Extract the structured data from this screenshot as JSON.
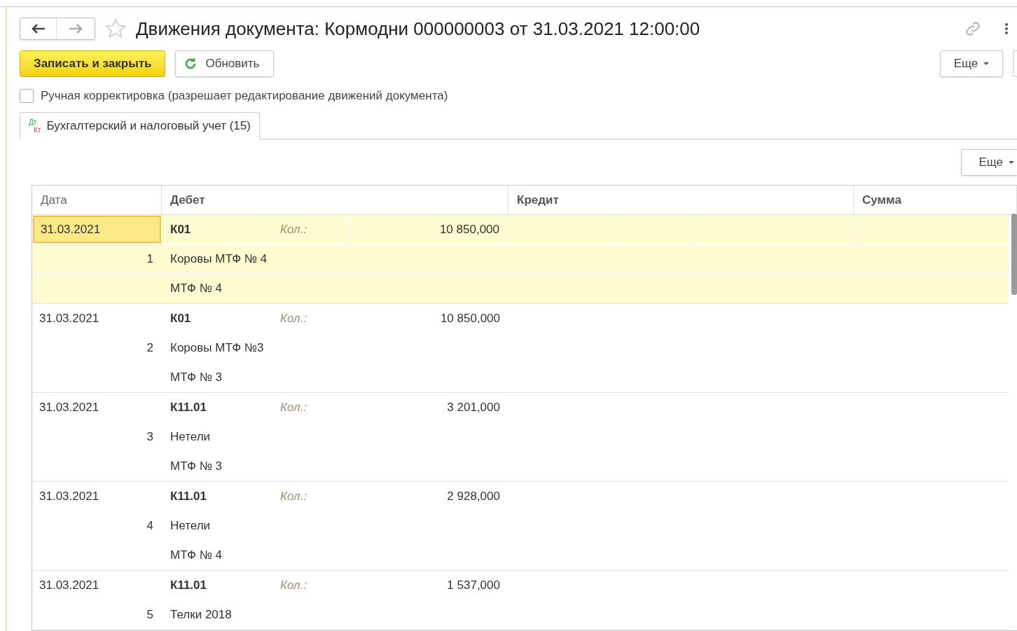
{
  "window": {
    "title": "Движения документа: Кормодни 000000003 от 31.03.2021 12:00:00"
  },
  "toolbar": {
    "save_close": "Записать и закрыть",
    "refresh": "Обновить",
    "more": "Еще"
  },
  "manual_edit": {
    "label": "Ручная корректировка (разрешает редактирование движений документа)",
    "checked": false
  },
  "tabs": [
    {
      "label": "Бухгалтерский и налоговый учет (15)",
      "icon_debit": "Дт",
      "icon_credit": "Кт",
      "selected": true
    }
  ],
  "table": {
    "more": "Еще",
    "columns": [
      "Дата",
      "Дебет",
      "Кредит",
      "Сумма"
    ],
    "rows": [
      {
        "date": "31.03.2021",
        "number": "1",
        "account": "К01",
        "qty_label": "Кол.:",
        "qty": "10 850,000",
        "subconto_1": "Коровы МТФ № 4",
        "subconto_2": "МТФ № 4",
        "selected": true
      },
      {
        "date": "31.03.2021",
        "number": "2",
        "account": "К01",
        "qty_label": "Кол.:",
        "qty": "10 850,000",
        "subconto_1": "Коровы МТФ №3",
        "subconto_2": "МТФ № 3",
        "selected": false
      },
      {
        "date": "31.03.2021",
        "number": "3",
        "account": "К11.01",
        "qty_label": "Кол.:",
        "qty": "3 201,000",
        "subconto_1": "Нетели",
        "subconto_2": "МТФ № 3",
        "selected": false
      },
      {
        "date": "31.03.2021",
        "number": "4",
        "account": "К11.01",
        "qty_label": "Кол.:",
        "qty": "2 928,000",
        "subconto_1": "Нетели",
        "subconto_2": "МТФ № 4",
        "selected": false
      },
      {
        "date": "31.03.2021",
        "number": "5",
        "account": "К11.01",
        "qty_label": "Кол.:",
        "qty": "1 537,000",
        "subconto_1": "Телки 2018",
        "selected": false
      }
    ]
  }
}
